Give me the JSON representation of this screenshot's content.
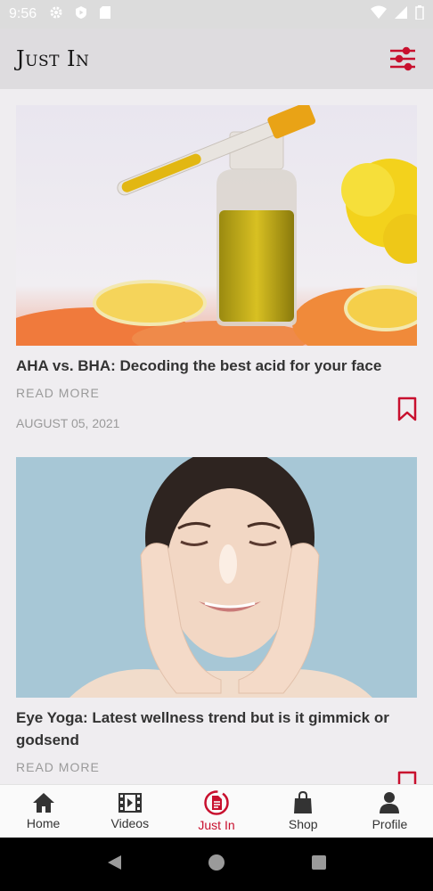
{
  "status_bar": {
    "time": "9:56"
  },
  "app_bar": {
    "title": "Just In"
  },
  "articles": [
    {
      "title": "AHA vs. BHA: Decoding the best acid for your face",
      "read_more": "READ MORE",
      "date": "AUGUST 05, 2021",
      "image": "serum-dropper-bottle-with-citrus"
    },
    {
      "title": "Eye Yoga: Latest wellness trend but is it gimmick or godsend",
      "read_more": "READ MORE",
      "date": "",
      "image": "woman-touching-face-eyes-closed"
    }
  ],
  "bottom_nav": {
    "items": [
      {
        "label": "Home",
        "icon": "home-icon"
      },
      {
        "label": "Videos",
        "icon": "video-icon"
      },
      {
        "label": "Just In",
        "icon": "document-icon",
        "active": true
      },
      {
        "label": "Shop",
        "icon": "shopping-bag-icon"
      },
      {
        "label": "Profile",
        "icon": "person-icon"
      }
    ]
  },
  "colors": {
    "accent": "#c8102e",
    "background": "#efedf0",
    "app_bar": "#dedcdf"
  }
}
